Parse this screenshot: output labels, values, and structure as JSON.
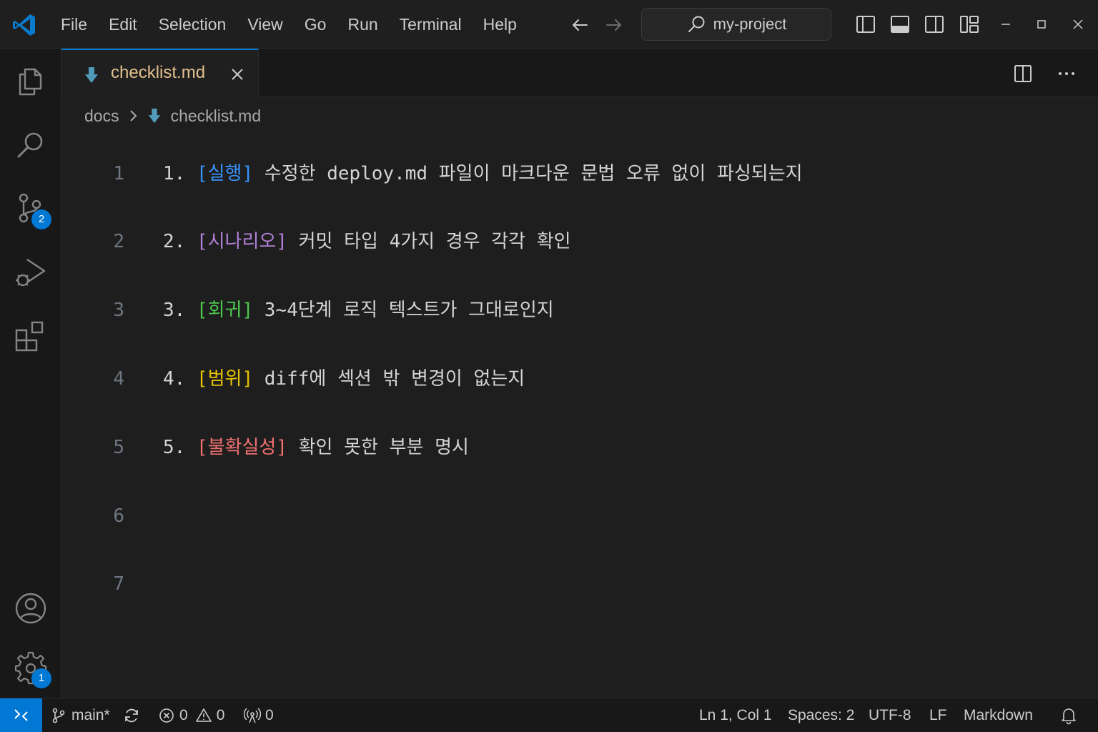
{
  "menu": [
    "File",
    "Edit",
    "Selection",
    "View",
    "Go",
    "Run",
    "Terminal",
    "Help"
  ],
  "search": {
    "text": "my-project"
  },
  "tab": {
    "label": "checklist.md",
    "icon": "markdown-icon",
    "label_color": "#e2c08d"
  },
  "breadcrumb": {
    "folder": "docs",
    "file": "checklist.md"
  },
  "activity": {
    "scm_badge": "2",
    "settings_badge": "1"
  },
  "editor": {
    "line_numbers": [
      "1",
      "2",
      "3",
      "4",
      "5",
      "6",
      "7"
    ],
    "lines": [
      {
        "num": "1.",
        "tag": "[실행]",
        "text": "수정한 deploy.md 파일이 마크다운 문법 오류 없이 파싱되는지"
      },
      {
        "num": "2.",
        "tag": "[시나리오]",
        "text": "커밋 타입 4가지 경우 각각 확인"
      },
      {
        "num": "3.",
        "tag": "[회귀]",
        "text": "3~4단계 로직 텍스트가 그대로인지"
      },
      {
        "num": "4.",
        "tag": "[범위]",
        "text": "diff에 섹션 밖 변경이 없는지"
      },
      {
        "num": "5.",
        "tag": "[불확실성]",
        "text": "확인 못한 부분 명시"
      }
    ],
    "tag_colors": {
      "exec": "#3794ff",
      "scenario": "#b180d7",
      "regression": "#4ec94e",
      "scope": "#e5c100",
      "uncertainty": "#f07070"
    }
  },
  "status": {
    "branch": "main*",
    "errors": "0",
    "warnings": "0",
    "ports": "0",
    "position": "Ln 1, Col 1",
    "spaces": "Spaces: 2",
    "encoding": "UTF-8",
    "eol": "LF",
    "language": "Markdown",
    "accent": "#0078d4"
  }
}
